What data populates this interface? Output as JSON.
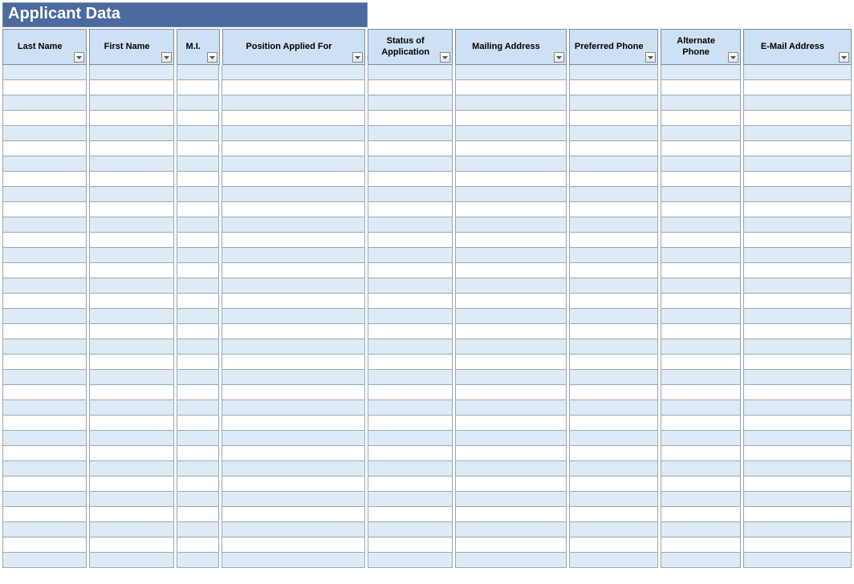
{
  "title": "Applicant Data",
  "columns": [
    {
      "label": "Last Name"
    },
    {
      "label": "First Name"
    },
    {
      "label": "M.I."
    },
    {
      "label": "Position Applied For"
    },
    {
      "label": "Status of Application"
    },
    {
      "label": "Mailing Address"
    },
    {
      "label": "Preferred Phone"
    },
    {
      "label": "Alternate Phone"
    },
    {
      "label": "E-Mail Address"
    }
  ],
  "row_count": 33,
  "colors": {
    "title_bg": "#4a6aa0",
    "header_bg": "#cde1f5",
    "row_even": "#deebf7",
    "row_odd": "#ffffff"
  }
}
